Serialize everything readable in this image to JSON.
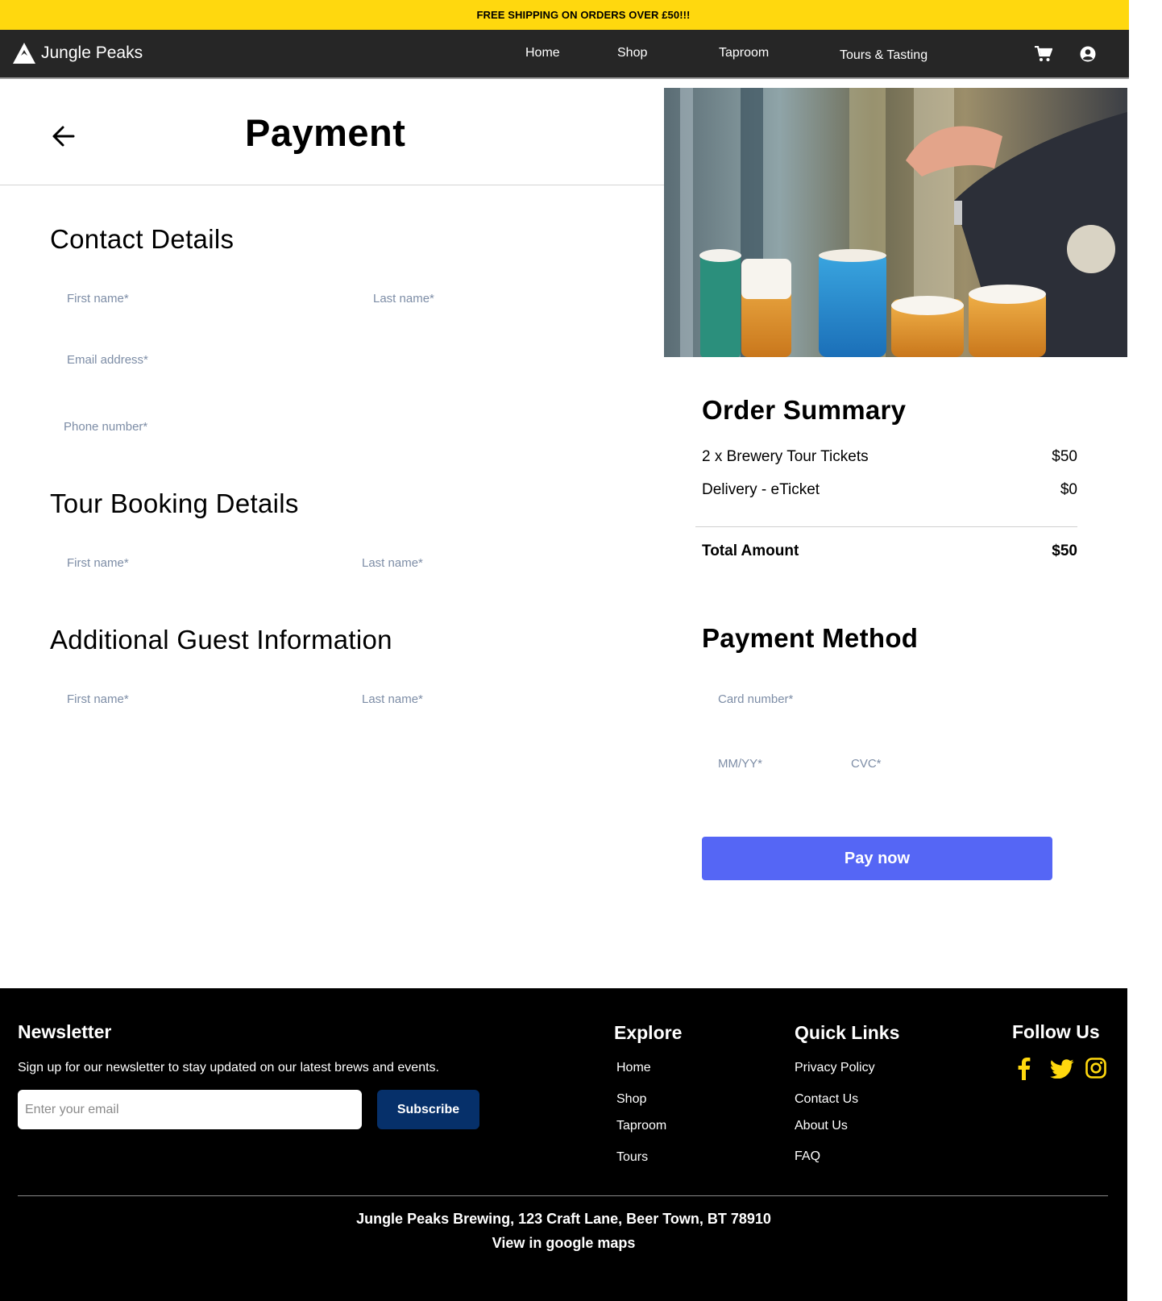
{
  "banner": {
    "text": "FREE SHIPPING ON ORDERS OVER £50!!!"
  },
  "nav": {
    "brand": "Jungle Peaks",
    "links": [
      "Home",
      "Shop",
      "Taproom",
      "Tours & Tasting"
    ],
    "icons": [
      "cart-icon",
      "user-account-icon"
    ]
  },
  "page": {
    "title": "Payment",
    "back_icon": "arrow-left-icon"
  },
  "contact": {
    "title": "Contact Details",
    "first_name_placeholder": "First name*",
    "last_name_placeholder": "Last name*",
    "email_placeholder": "Email address*",
    "phone_placeholder": "Phone number*"
  },
  "tour_booking": {
    "title": "Tour Booking Details",
    "first_name_placeholder": "First name*",
    "last_name_placeholder": "Last name*"
  },
  "guest": {
    "title": "Additional Guest Information",
    "first_name_placeholder": "First name*",
    "last_name_placeholder": "Last name*"
  },
  "order_summary": {
    "title": "Order Summary",
    "items": [
      {
        "label": "2 x Brewery Tour Tickets",
        "amount": "$50"
      },
      {
        "label": "Delivery - eTicket",
        "amount": "$0"
      }
    ],
    "total_label": "Total Amount",
    "total_amount": "$50"
  },
  "payment_method": {
    "title": "Payment Method",
    "card_placeholder": "Card number*",
    "expiry_placeholder": "MM/YY*",
    "cvc_placeholder": "CVC*",
    "pay_label": "Pay now",
    "pay_color": "#5566f5"
  },
  "footer": {
    "newsletter_title": "Newsletter",
    "newsletter_text": "Sign up for our newsletter to stay updated on our latest brews and events.",
    "email_placeholder": "Enter your email",
    "subscribe_label": "Subscribe",
    "explore_title": "Explore",
    "explore_links": [
      "Home",
      "Shop",
      "Taproom",
      "Tours"
    ],
    "quick_title": "Quick Links",
    "quick_links": [
      "Privacy Policy",
      "Contact Us",
      "About Us",
      "FAQ"
    ],
    "follow_title": "Follow Us",
    "social_icons": [
      "facebook-icon",
      "twitter-icon",
      "instagram-icon"
    ],
    "social_color": "#ffd80e",
    "address": "Jungle Peaks Brewing, 123 Craft Lane, Beer Town, BT 78910",
    "maps_link": "View in google maps"
  },
  "colors": {
    "banner": "#ffd80e",
    "nav": "#262626",
    "footer": "#000000",
    "subscribe": "#06306a"
  }
}
